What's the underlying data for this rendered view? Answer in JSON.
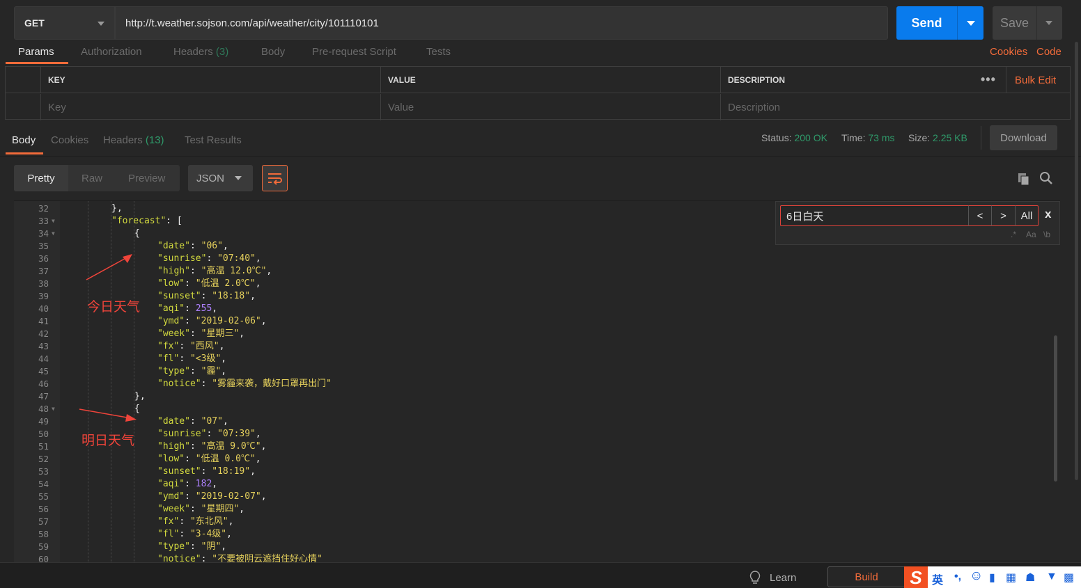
{
  "request": {
    "method": "GET",
    "url": "http://t.weather.sojson.com/api/weather/city/101110101",
    "send_label": "Send",
    "save_label": "Save"
  },
  "request_tabs": {
    "params": "Params",
    "authorization": "Authorization",
    "headers": "Headers",
    "headers_count": "(3)",
    "body": "Body",
    "prerequest": "Pre-request Script",
    "tests": "Tests",
    "cookies": "Cookies",
    "code": "Code"
  },
  "params_table": {
    "key_header": "KEY",
    "value_header": "VALUE",
    "description_header": "DESCRIPTION",
    "more": "•••",
    "bulk_edit": "Bulk Edit",
    "key_placeholder": "Key",
    "value_placeholder": "Value",
    "description_placeholder": "Description"
  },
  "response_tabs": {
    "body": "Body",
    "cookies": "Cookies",
    "headers": "Headers",
    "headers_count": "(13)",
    "test_results": "Test Results"
  },
  "status": {
    "status_label": "Status:",
    "status_value": "200 OK",
    "time_label": "Time:",
    "time_value": "73 ms",
    "size_label": "Size:",
    "size_value": "2.25 KB",
    "download": "Download"
  },
  "body_toolbar": {
    "pretty": "Pretty",
    "raw": "Raw",
    "preview": "Preview",
    "format": "JSON"
  },
  "find": {
    "query": "6日白天",
    "prev": "<",
    "next": ">",
    "all": "All",
    "close": "x",
    "opt_regex": ".*",
    "opt_case": "Aa",
    "opt_word": "\\b"
  },
  "annotations": {
    "today": "今日天气",
    "tomorrow": "明日天气"
  },
  "code_lines": [
    {
      "n": "32",
      "fold": false,
      "indent": 2,
      "html": "},"
    },
    {
      "n": "33",
      "fold": true,
      "indent": 2,
      "html": "\"forecast\": ["
    },
    {
      "n": "34",
      "fold": true,
      "indent": 3,
      "html": "{"
    },
    {
      "n": "35",
      "fold": false,
      "indent": 4,
      "key": "date",
      "val": "\"06\""
    },
    {
      "n": "36",
      "fold": false,
      "indent": 4,
      "key": "sunrise",
      "val": "\"07:40\""
    },
    {
      "n": "37",
      "fold": false,
      "indent": 4,
      "key": "high",
      "val": "\"高温 12.0℃\""
    },
    {
      "n": "38",
      "fold": false,
      "indent": 4,
      "key": "low",
      "val": "\"低温 2.0℃\""
    },
    {
      "n": "39",
      "fold": false,
      "indent": 4,
      "key": "sunset",
      "val": "\"18:18\""
    },
    {
      "n": "40",
      "fold": false,
      "indent": 4,
      "key": "aqi",
      "num": "255"
    },
    {
      "n": "41",
      "fold": false,
      "indent": 4,
      "key": "ymd",
      "val": "\"2019-02-06\""
    },
    {
      "n": "42",
      "fold": false,
      "indent": 4,
      "key": "week",
      "val": "\"星期三\""
    },
    {
      "n": "43",
      "fold": false,
      "indent": 4,
      "key": "fx",
      "val": "\"西风\""
    },
    {
      "n": "44",
      "fold": false,
      "indent": 4,
      "key": "fl",
      "val": "\"<3级\""
    },
    {
      "n": "45",
      "fold": false,
      "indent": 4,
      "key": "type",
      "val": "\"霾\""
    },
    {
      "n": "46",
      "fold": false,
      "indent": 4,
      "key": "notice",
      "val": "\"雾霾来袭，戴好口罩再出门\"",
      "last": true
    },
    {
      "n": "47",
      "fold": false,
      "indent": 3,
      "html": "},"
    },
    {
      "n": "48",
      "fold": true,
      "indent": 3,
      "html": "{"
    },
    {
      "n": "49",
      "fold": false,
      "indent": 4,
      "key": "date",
      "val": "\"07\""
    },
    {
      "n": "50",
      "fold": false,
      "indent": 4,
      "key": "sunrise",
      "val": "\"07:39\""
    },
    {
      "n": "51",
      "fold": false,
      "indent": 4,
      "key": "high",
      "val": "\"高温 9.0℃\""
    },
    {
      "n": "52",
      "fold": false,
      "indent": 4,
      "key": "low",
      "val": "\"低温 0.0℃\""
    },
    {
      "n": "53",
      "fold": false,
      "indent": 4,
      "key": "sunset",
      "val": "\"18:19\""
    },
    {
      "n": "54",
      "fold": false,
      "indent": 4,
      "key": "aqi",
      "num": "182"
    },
    {
      "n": "55",
      "fold": false,
      "indent": 4,
      "key": "ymd",
      "val": "\"2019-02-07\""
    },
    {
      "n": "56",
      "fold": false,
      "indent": 4,
      "key": "week",
      "val": "\"星期四\""
    },
    {
      "n": "57",
      "fold": false,
      "indent": 4,
      "key": "fx",
      "val": "\"东北风\""
    },
    {
      "n": "58",
      "fold": false,
      "indent": 4,
      "key": "fl",
      "val": "\"3-4级\""
    },
    {
      "n": "59",
      "fold": false,
      "indent": 4,
      "key": "type",
      "val": "\"阴\""
    },
    {
      "n": "60",
      "fold": false,
      "indent": 4,
      "key": "notice",
      "val": "\"不要被阴云遮挡住好心情\"",
      "last": true
    }
  ],
  "footer": {
    "learn": "Learn",
    "build": "Build",
    "ime_label": "英"
  },
  "colors": {
    "accent": "#f26b3a",
    "send": "#097bed",
    "status_ok": "#2f9a6a",
    "annotation": "#f0443a"
  }
}
